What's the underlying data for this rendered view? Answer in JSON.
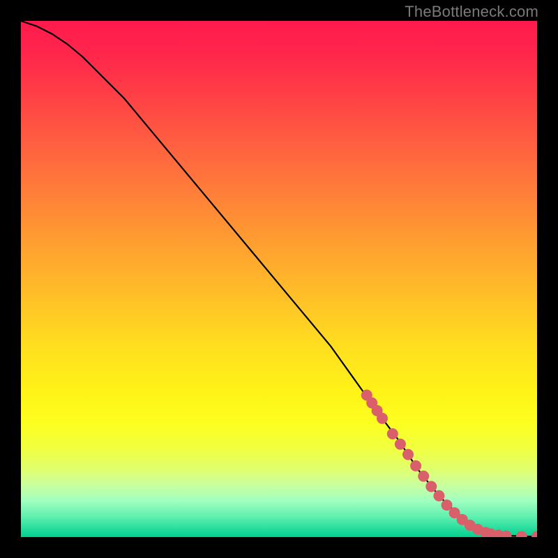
{
  "attribution": "TheBottleneck.com",
  "chart_data": {
    "type": "line",
    "title": "",
    "xlabel": "",
    "ylabel": "",
    "xlim": [
      0,
      100
    ],
    "ylim": [
      0,
      100
    ],
    "grid": false,
    "series": [
      {
        "name": "curve",
        "color": "#000000",
        "x": [
          0,
          3,
          6,
          9,
          12,
          15,
          20,
          25,
          30,
          35,
          40,
          45,
          50,
          55,
          60,
          65,
          70,
          73,
          75,
          77,
          79,
          81,
          83,
          85,
          87,
          89,
          91,
          93,
          95,
          97,
          99,
          100
        ],
        "y": [
          100,
          99,
          97.5,
          95.5,
          93,
          90,
          85,
          79,
          73,
          67,
          61,
          55,
          49,
          43,
          37,
          30,
          23,
          19,
          16,
          13,
          10.5,
          8,
          6,
          4.2,
          2.8,
          1.8,
          1.0,
          0.5,
          0.25,
          0.15,
          0.1,
          0.1
        ]
      }
    ],
    "markers": [
      {
        "x": 67,
        "y": 27.5
      },
      {
        "x": 68,
        "y": 26
      },
      {
        "x": 69,
        "y": 24.5
      },
      {
        "x": 70,
        "y": 23
      },
      {
        "x": 72,
        "y": 20
      },
      {
        "x": 73.5,
        "y": 18
      },
      {
        "x": 75,
        "y": 16
      },
      {
        "x": 76.5,
        "y": 13.8
      },
      {
        "x": 78,
        "y": 11.8
      },
      {
        "x": 79.5,
        "y": 9.8
      },
      {
        "x": 81,
        "y": 8
      },
      {
        "x": 82.5,
        "y": 6.2
      },
      {
        "x": 84,
        "y": 4.7
      },
      {
        "x": 85.5,
        "y": 3.4
      },
      {
        "x": 87,
        "y": 2.3
      },
      {
        "x": 88.5,
        "y": 1.5
      },
      {
        "x": 90,
        "y": 0.9
      },
      {
        "x": 91,
        "y": 0.6
      },
      {
        "x": 92.5,
        "y": 0.35
      },
      {
        "x": 94,
        "y": 0.2
      },
      {
        "x": 97,
        "y": 0.1
      },
      {
        "x": 100,
        "y": 0.1
      }
    ],
    "marker_style": {
      "color": "#d9606a",
      "radius_px": 8
    }
  }
}
